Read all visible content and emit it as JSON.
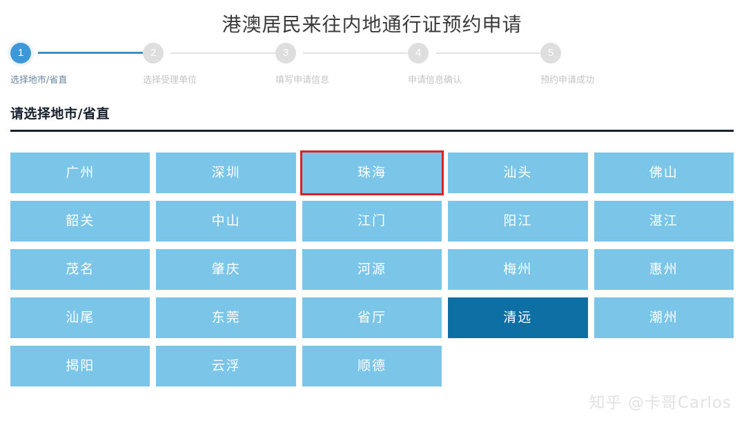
{
  "header": {
    "title": "港澳居民来往内地通行证预约申请"
  },
  "stepper": {
    "steps": [
      {
        "number": "1",
        "label": "选择地市/省直",
        "state": "active"
      },
      {
        "number": "2",
        "label": "选择受理单位",
        "state": "inactive"
      },
      {
        "number": "3",
        "label": "填写申请信息",
        "state": "inactive"
      },
      {
        "number": "4",
        "label": "申请信息确认",
        "state": "inactive"
      },
      {
        "number": "5",
        "label": "预约申请成功",
        "state": "inactive"
      }
    ]
  },
  "section": {
    "title": "请选择地市/省直"
  },
  "city_grid": {
    "tiles": [
      {
        "label": "广州",
        "state": "normal"
      },
      {
        "label": "深圳",
        "state": "normal"
      },
      {
        "label": "珠海",
        "state": "annotated"
      },
      {
        "label": "汕头",
        "state": "normal"
      },
      {
        "label": "佛山",
        "state": "normal"
      },
      {
        "label": "韶关",
        "state": "normal"
      },
      {
        "label": "中山",
        "state": "normal"
      },
      {
        "label": "江门",
        "state": "normal"
      },
      {
        "label": "阳江",
        "state": "normal"
      },
      {
        "label": "湛江",
        "state": "normal"
      },
      {
        "label": "茂名",
        "state": "normal"
      },
      {
        "label": "肇庆",
        "state": "normal"
      },
      {
        "label": "河源",
        "state": "normal"
      },
      {
        "label": "梅州",
        "state": "normal"
      },
      {
        "label": "惠州",
        "state": "normal"
      },
      {
        "label": "汕尾",
        "state": "normal"
      },
      {
        "label": "东莞",
        "state": "normal"
      },
      {
        "label": "省厅",
        "state": "normal"
      },
      {
        "label": "清远",
        "state": "selected"
      },
      {
        "label": "潮州",
        "state": "normal"
      },
      {
        "label": "揭阳",
        "state": "normal"
      },
      {
        "label": "云浮",
        "state": "normal"
      },
      {
        "label": "顺德",
        "state": "normal"
      },
      {
        "label": "",
        "state": "empty"
      },
      {
        "label": "",
        "state": "empty"
      }
    ]
  },
  "watermark": {
    "text": "知乎 @卡哥Carlos"
  },
  "colors": {
    "tile": "#7bc6e8",
    "tile_selected": "#0d6fa3",
    "annotation": "#e02020",
    "step_active": "#3e98d8",
    "step_inactive": "#dedede",
    "rule": "#17202b"
  }
}
